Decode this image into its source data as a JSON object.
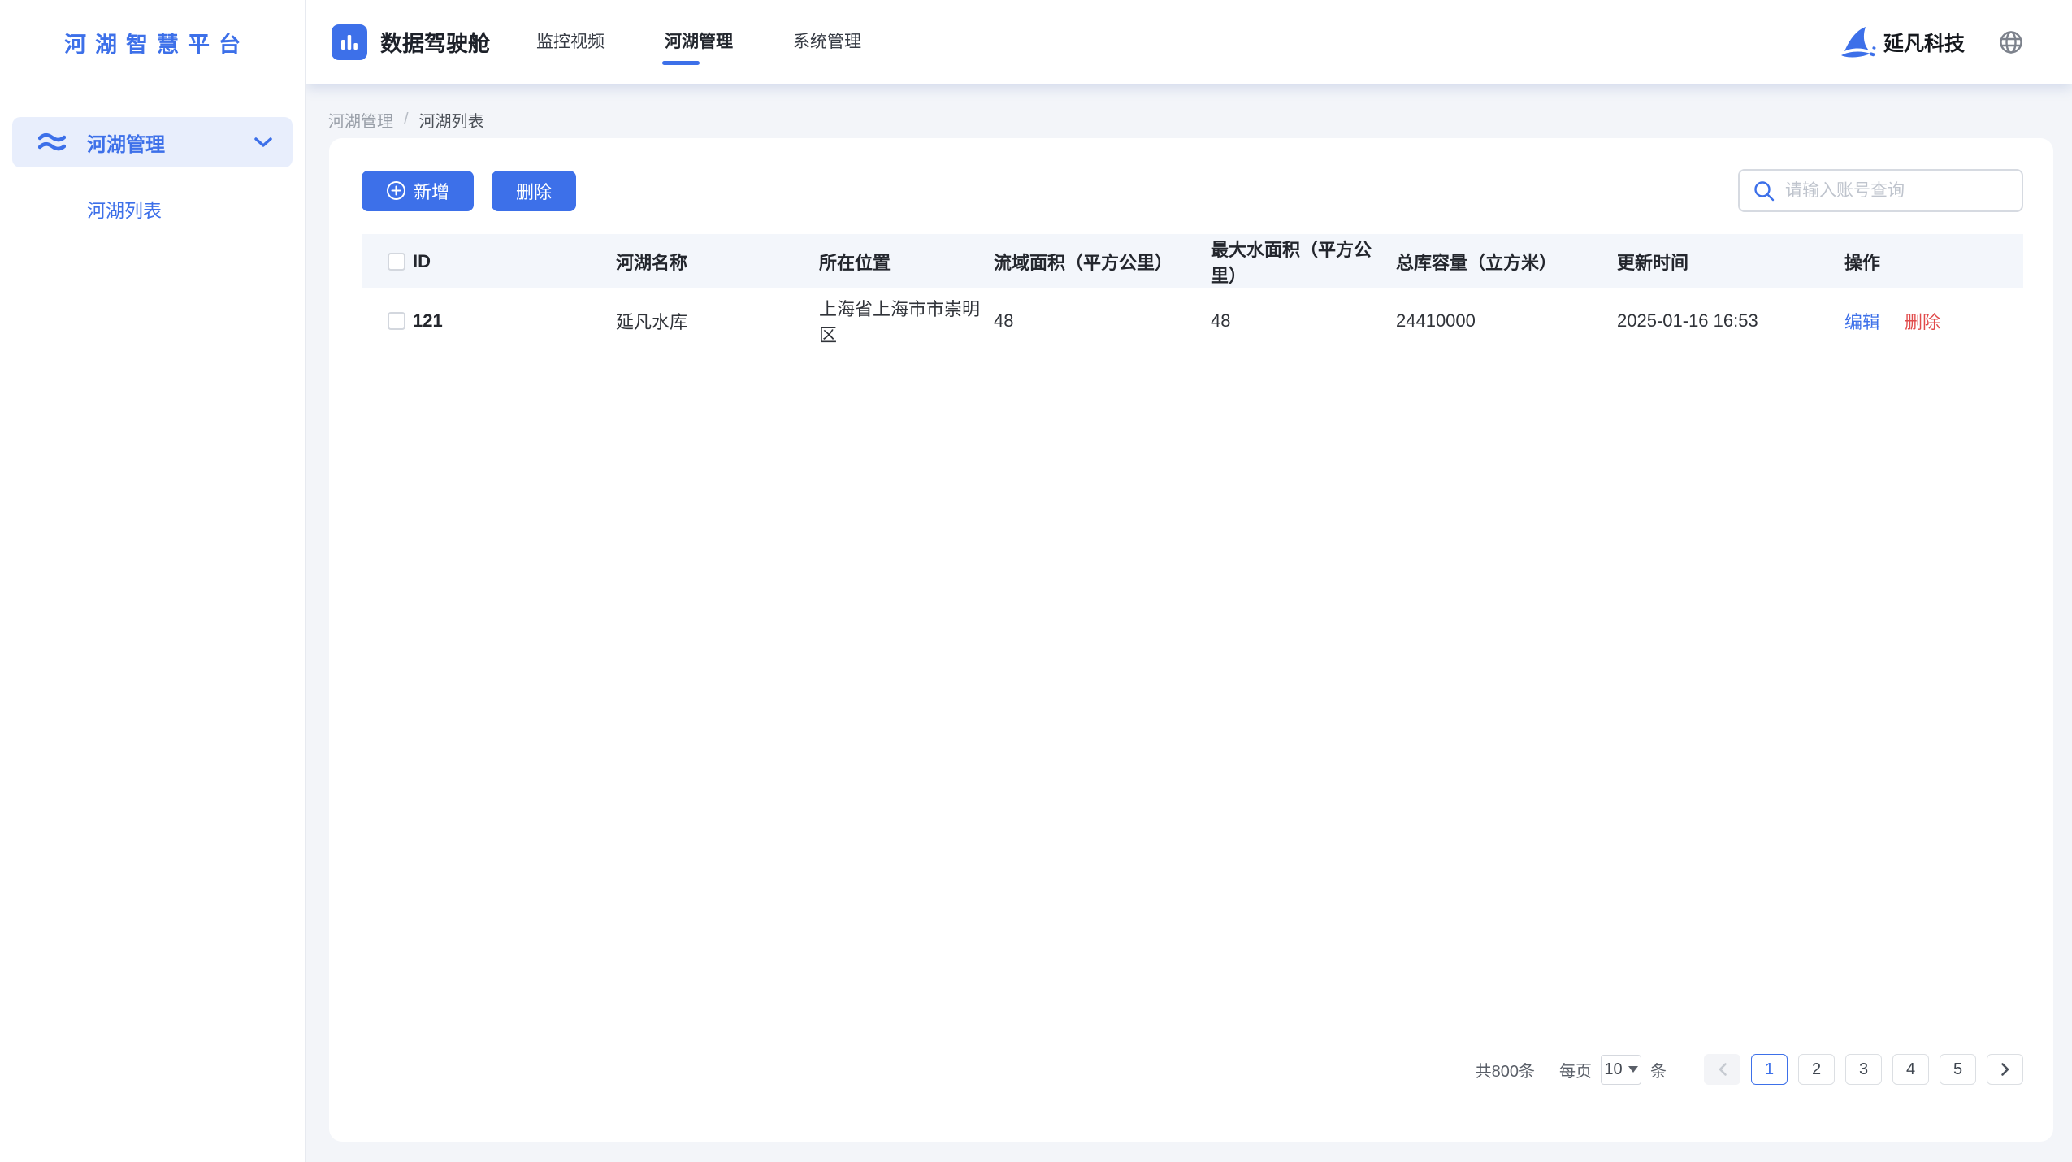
{
  "colors": {
    "primary": "#3d70e9",
    "danger": "#e14b4b"
  },
  "sidebar": {
    "logo_text": "河湖智慧平台",
    "menu_label": "河湖管理",
    "submenu_label": "河湖列表"
  },
  "topnav": {
    "brand": "数据驾驶舱",
    "items": [
      {
        "label": "监控视频"
      },
      {
        "label": "河湖管理",
        "active": true
      },
      {
        "label": "系统管理"
      }
    ],
    "company": "延凡科技"
  },
  "breadcrumb": {
    "items": [
      "河湖管理",
      "河湖列表"
    ],
    "separator": "/"
  },
  "toolbar": {
    "add_label": "新增",
    "delete_label": "删除",
    "search_placeholder": "请输入账号查询"
  },
  "table": {
    "columns": [
      "ID",
      "河湖名称",
      "所在位置",
      "流域面积（平方公里）",
      "最大水面积（平方公里）",
      "总库容量（立方米）",
      "更新时间",
      "操作"
    ],
    "rows": [
      {
        "id": "121",
        "name": "延凡水库",
        "location": "上海省上海市市崇明区",
        "basin_area": "48",
        "max_water_area": "48",
        "total_capacity": "24410000",
        "updated_at": "2025-01-16 16:53",
        "edit_label": "编辑",
        "delete_label": "删除"
      }
    ]
  },
  "pagination": {
    "total_text": "共800条",
    "per_page_prefix": "每页",
    "per_page_value": "10",
    "per_page_suffix": "条",
    "pages": [
      "1",
      "2",
      "3",
      "4",
      "5"
    ],
    "active_page": "1"
  }
}
